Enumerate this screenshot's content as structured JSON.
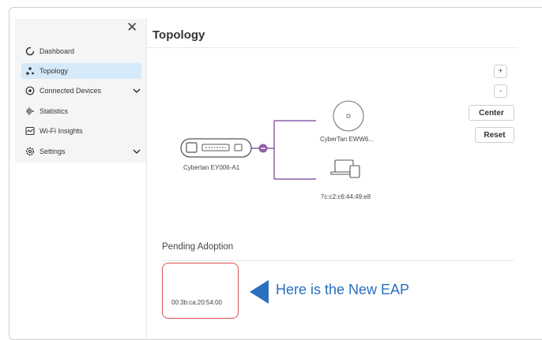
{
  "sidebar": {
    "items": [
      {
        "label": "Dashboard",
        "icon": "dashboard-icon"
      },
      {
        "label": "Topology",
        "icon": "topology-icon",
        "active": true
      },
      {
        "label": "Connected Devices",
        "icon": "connected-devices-icon",
        "expandable": true
      },
      {
        "label": "Statistics",
        "icon": "statistics-icon"
      },
      {
        "label": "Wi-Fi Insights",
        "icon": "wifi-insights-icon"
      },
      {
        "label": "Settings",
        "icon": "settings-icon",
        "expandable": true
      }
    ]
  },
  "header": {
    "title": "Topology"
  },
  "controls": {
    "zoom_in": "+",
    "zoom_out": "-",
    "center": "Center",
    "reset": "Reset"
  },
  "topology": {
    "gateway_label": "Cybertan EY006-A1",
    "ap_label": "CyberTan EWW6...",
    "client_label": "7c:c2:c6:44:49:e8"
  },
  "pending": {
    "title": "Pending Adoption",
    "device_mac": "00:3b:ca:20:54:00"
  },
  "annotation": {
    "text": "Here is the New EAP"
  },
  "colors": {
    "accent": "#8e5fa8",
    "active_nav": "#d6e9f8",
    "callout": "#2a6fc0",
    "highlight_border": "#d9534f"
  }
}
